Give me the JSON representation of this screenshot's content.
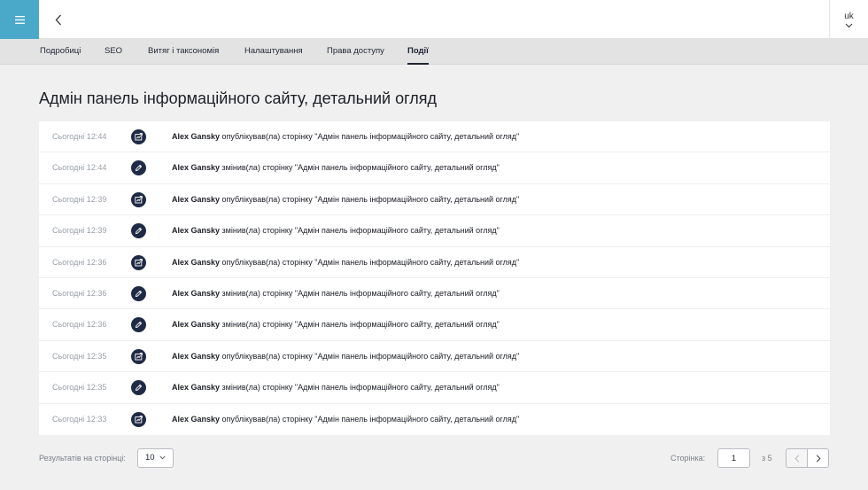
{
  "header": {
    "menu_icon": "hamburger-icon",
    "back_icon": "chevron-left-icon",
    "lang": "uk",
    "accent_color": "#4aa9c9"
  },
  "tabs": [
    {
      "label": "Подробиці",
      "active": false
    },
    {
      "label": "SEO",
      "active": false
    },
    {
      "label": "Витяг і таксономія",
      "active": false
    },
    {
      "label": "Налаштування",
      "active": false
    },
    {
      "label": "Права доступу",
      "active": false
    },
    {
      "label": "Події",
      "active": true
    }
  ],
  "page_title": "Адмін панель інформаційного сайту, детальний огляд",
  "events": [
    {
      "time": "Сьогодні 12:44",
      "icon": "publish-icon",
      "user": "Alex Gansky",
      "text": " опублікував(ла) сторінку \"Адмін панель інформаційного сайту, детальний огляд\""
    },
    {
      "time": "Сьогодні 12:44",
      "icon": "edit-icon",
      "user": "Alex Gansky",
      "text": " змінив(ла) сторінку \"Адмін панель інформаційного сайту, детальний огляд\""
    },
    {
      "time": "Сьогодні 12:39",
      "icon": "publish-icon",
      "user": "Alex Gansky",
      "text": " опублікував(ла) сторінку \"Адмін панель інформаційного сайту, детальний огляд\""
    },
    {
      "time": "Сьогодні 12:39",
      "icon": "edit-icon",
      "user": "Alex Gansky",
      "text": " змінив(ла) сторінку \"Адмін панель інформаційного сайту, детальний огляд\""
    },
    {
      "time": "Сьогодні 12:36",
      "icon": "publish-icon",
      "user": "Alex Gansky",
      "text": " опублікував(ла) сторінку \"Адмін панель інформаційного сайту, детальний огляд\""
    },
    {
      "time": "Сьогодні 12:36",
      "icon": "edit-icon",
      "user": "Alex Gansky",
      "text": " змінив(ла) сторінку \"Адмін панель інформаційного сайту, детальний огляд\""
    },
    {
      "time": "Сьогодні 12:36",
      "icon": "edit-icon",
      "user": "Alex Gansky",
      "text": " змінив(ла) сторінку \"Адмін панель інформаційного сайту, детальний огляд\""
    },
    {
      "time": "Сьогодні 12:35",
      "icon": "publish-icon",
      "user": "Alex Gansky",
      "text": " опублікував(ла) сторінку \"Адмін панель інформаційного сайту, детальний огляд\""
    },
    {
      "time": "Сьогодні 12:35",
      "icon": "edit-icon",
      "user": "Alex Gansky",
      "text": " змінив(ла) сторінку \"Адмін панель інформаційного сайту, детальний огляд\""
    },
    {
      "time": "Сьогодні 12:33",
      "icon": "publish-icon",
      "user": "Alex Gansky",
      "text": " опублікував(ла) сторінку \"Адмін панель інформаційного сайту, детальний огляд\""
    }
  ],
  "pagination": {
    "results_label": "Результатів на сторінці:",
    "per_page": "10",
    "page_label": "Сторінка:",
    "page": "1",
    "of_label": "з 5"
  }
}
